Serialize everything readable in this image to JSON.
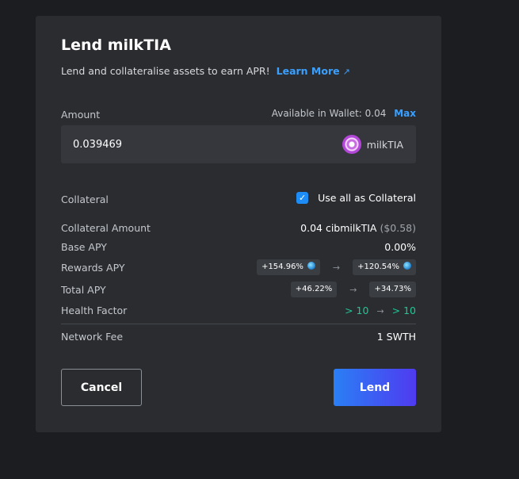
{
  "modal": {
    "title": "Lend milkTIA",
    "subtitle": "Lend and collateralise assets to earn APR!",
    "learn_more": "Learn More",
    "learn_more_arrow": "↗"
  },
  "amount": {
    "label": "Amount",
    "available_label": "Available in Wallet: 0.04",
    "max_label": "Max",
    "value": "0.039469",
    "token": "milkTIA"
  },
  "collateral": {
    "label": "Collateral",
    "checkbox_checked": true,
    "checkbox_label": "Use all as Collateral"
  },
  "details": {
    "collateral_amount_label": "Collateral Amount",
    "collateral_amount_value": "0.04 cibmilkTIA",
    "collateral_amount_usd": "($0.58)",
    "base_apy_label": "Base APY",
    "base_apy_value": "0.00%",
    "rewards_apy_label": "Rewards APY",
    "rewards_apy_from": "+154.96%",
    "rewards_apy_to": "+120.54%",
    "total_apy_label": "Total APY",
    "total_apy_from": "+46.22%",
    "total_apy_to": "+34.73%",
    "health_factor_label": "Health Factor",
    "health_factor_from": "> 10",
    "health_factor_to": "> 10",
    "network_fee_label": "Network Fee",
    "network_fee_value": "1 SWTH",
    "arrow": "→"
  },
  "buttons": {
    "cancel": "Cancel",
    "lend": "Lend"
  },
  "colors": {
    "accent": "#3aa0ff",
    "positive": "#1fc796",
    "lend_gradient_start": "#2a7ff5",
    "lend_gradient_end": "#4f3bf0"
  },
  "icons": {
    "token": "milktia-token-icon",
    "reward": "reward-coin-icon",
    "check": "check-icon",
    "external": "external-link-icon"
  }
}
